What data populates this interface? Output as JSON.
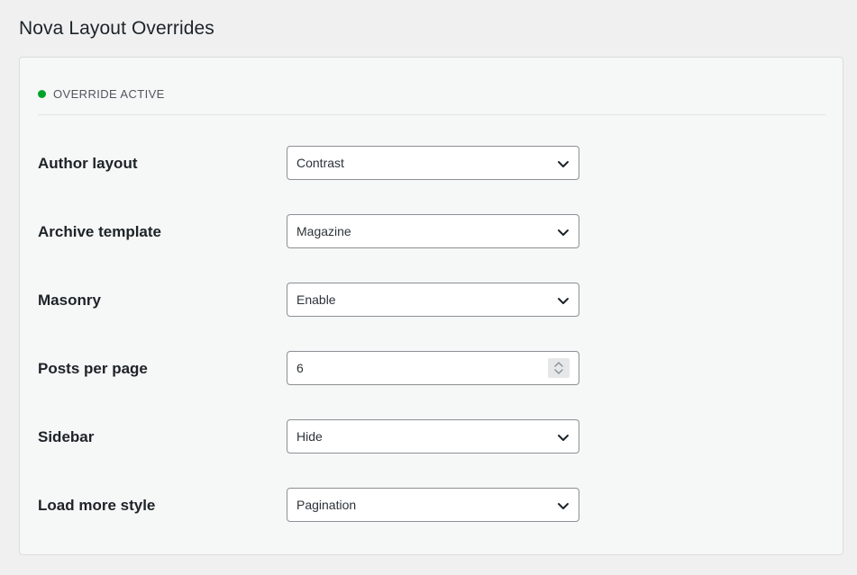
{
  "page": {
    "title": "Nova Layout Overrides"
  },
  "status": {
    "text": "OVERRIDE ACTIVE",
    "color": "#00a32a",
    "icon": "status-dot-icon"
  },
  "fields": [
    {
      "label": "Author layout",
      "type": "select",
      "value": "Contrast",
      "icon": "chevron-down-icon"
    },
    {
      "label": "Archive template",
      "type": "select",
      "value": "Magazine",
      "icon": "chevron-down-icon"
    },
    {
      "label": "Masonry",
      "type": "select",
      "value": "Enable",
      "icon": "chevron-down-icon"
    },
    {
      "label": "Posts per page",
      "type": "number",
      "value": "6",
      "icon": "spinner-arrows-icon"
    },
    {
      "label": "Sidebar",
      "type": "select",
      "value": "Hide",
      "icon": "chevron-down-icon"
    },
    {
      "label": "Load more style",
      "type": "select",
      "value": "Pagination",
      "icon": "chevron-down-icon"
    }
  ]
}
